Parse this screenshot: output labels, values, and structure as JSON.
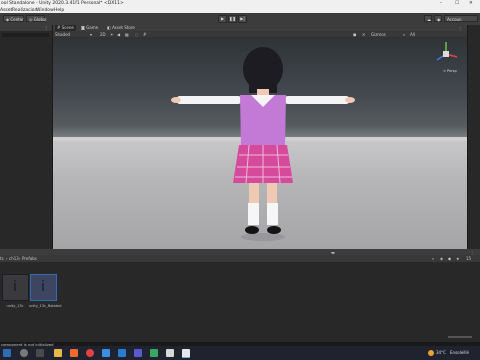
{
  "window": {
    "title": "ool Standalone - Unity 2020.3.41f1 Personal* <DX11>",
    "controls": [
      "–",
      "☐",
      "✕"
    ]
  },
  "menu": [
    "Asset",
    "Realizacion",
    "Window",
    "Help"
  ],
  "toolbar": {
    "left_buttons": [
      "Center",
      "Global"
    ],
    "right_label": "Accoun"
  },
  "scene_tabs": [
    "Scene",
    "Game",
    "Asset Store"
  ],
  "scene_toolbar": {
    "shading_mode": "Shaded",
    "view_2d": "2D",
    "gizmos": "Gizmos",
    "search": "All"
  },
  "gizmo": {
    "label": "< Persp"
  },
  "project": {
    "breadcrumb": [
      "ts",
      "ch13",
      "Prefabs"
    ],
    "assets": [
      {
        "name": "unity_13c"
      },
      {
        "name": "unity_13c_Rotated"
      }
    ],
    "slider_count": "15"
  },
  "status_bar": {
    "message": "component is not initialized"
  },
  "taskbar": {
    "weather": "34°C",
    "weather_desc": "Ensoleillé"
  },
  "colors": {
    "editor_bg": "#282828",
    "toolbar_bg": "#3c3c3c",
    "accent_blue": "#2f6db5",
    "skirt_pink": "#d64a9c",
    "vest_purple": "#c27ad6"
  }
}
